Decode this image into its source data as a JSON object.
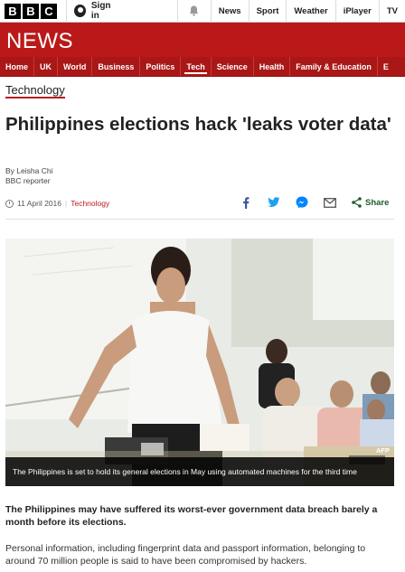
{
  "brand": {
    "letters": [
      "B",
      "B",
      "C"
    ]
  },
  "account": {
    "signin_label": "Sign in"
  },
  "top_nav": [
    {
      "label": "News"
    },
    {
      "label": "Sport"
    },
    {
      "label": "Weather"
    },
    {
      "label": "iPlayer"
    },
    {
      "label": "TV"
    }
  ],
  "news_band": {
    "title": "NEWS"
  },
  "section_nav": [
    {
      "label": "Home"
    },
    {
      "label": "UK"
    },
    {
      "label": "World"
    },
    {
      "label": "Business"
    },
    {
      "label": "Politics"
    },
    {
      "label": "Tech",
      "active": true
    },
    {
      "label": "Science"
    },
    {
      "label": "Health"
    },
    {
      "label": "Family & Education"
    },
    {
      "label": "E"
    }
  ],
  "article": {
    "section_label": "Technology",
    "headline": "Philippines elections hack 'leaks voter data'",
    "author": "By Leisha Chi",
    "author_role": "BBC reporter",
    "date": "11 April 2016",
    "category": "Technology",
    "share_label": "Share",
    "image_credit": "AFP",
    "caption": "The Philippines is set to hold its general elections in May using automated machines for the third time",
    "lead": "The Philippines may have suffered its worst-ever government data breach barely a month before its elections.",
    "paragraph": "Personal information, including fingerprint data and passport information, belonging to around 70 million people is said to have been compromised by hackers."
  },
  "icons": {
    "bell": "bell-icon",
    "facebook": "facebook-icon",
    "twitter": "twitter-icon",
    "messenger": "messenger-icon",
    "email": "email-icon",
    "share": "share-icon",
    "clock": "clock-icon"
  },
  "colors": {
    "brand_red": "#bb1919",
    "nav_red": "#a91717",
    "facebook": "#3b5998",
    "twitter": "#1da1f2",
    "messenger": "#0084ff",
    "share_green": "#1a5c2e"
  }
}
